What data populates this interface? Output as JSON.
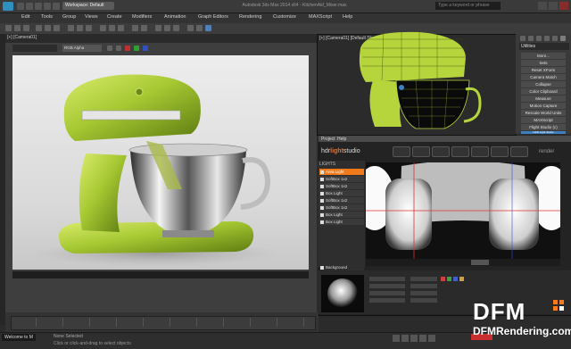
{
  "window": {
    "workspace": "Workspace: Default",
    "title": "Autodesk 3ds Max 2014 x64 - KitchenAid_Mixer.max",
    "search_placeholder": "Type a keyword or phrase"
  },
  "menu": [
    "Edit",
    "Tools",
    "Group",
    "Views",
    "Create",
    "Modifiers",
    "Animation",
    "Graph Editors",
    "Rendering",
    "Customize",
    "MAXScript",
    "Help"
  ],
  "left_viewport": {
    "label": "[+] [Camera01]",
    "tab_label": "RGB Alpha"
  },
  "right_viewport": {
    "label": "[+] [Camera01] [Default Shading]"
  },
  "command_panel": {
    "dropdown": "Utilities",
    "items": [
      {
        "label": "More...",
        "selected": false
      },
      {
        "label": "Sets",
        "selected": false
      },
      {
        "label": "Reset XForm",
        "selected": false
      },
      {
        "label": "Camera Match",
        "selected": false
      },
      {
        "label": "Collapse",
        "selected": false
      },
      {
        "label": "Color Clipboard",
        "selected": false
      },
      {
        "label": "Measure",
        "selected": false
      },
      {
        "label": "Motion Capture",
        "selected": false
      },
      {
        "label": "Rescale World Units",
        "selected": false
      },
      {
        "label": "MAXScript",
        "selected": false
      },
      {
        "label": "Flight Studio (c)",
        "selected": false
      },
      {
        "label": "HDR Light Studio",
        "selected": true
      }
    ]
  },
  "hdr_light_studio": {
    "menu": [
      "Project",
      "Help"
    ],
    "logo_prefix": "hdr",
    "logo_mid": "light",
    "logo_suffix": "studio",
    "render_label": "render",
    "lights_header": "LIGHTS",
    "lights": [
      {
        "label": "Area Light",
        "selected": true
      },
      {
        "label": "SoftBox 1x2",
        "selected": false
      },
      {
        "label": "SoftBox 1x2",
        "selected": false
      },
      {
        "label": "Box Light",
        "selected": false
      },
      {
        "label": "SoftBox 1x2",
        "selected": false
      },
      {
        "label": "SoftBox 1x2",
        "selected": false
      },
      {
        "label": "Box Light",
        "selected": false
      },
      {
        "label": "Box Light",
        "selected": false
      }
    ],
    "background_label": "Background"
  },
  "status": {
    "selection": "None Selected",
    "prompt": "Click or click-and-drag to select objects",
    "welcome": "Welcome to M"
  },
  "watermark": {
    "brand": "DFM",
    "url": "DFMRendering.com"
  },
  "colors": {
    "mixer_green": "#b6d53c",
    "selection_orange": "#f07a1a",
    "highlight_blue": "#3e7fbf"
  }
}
